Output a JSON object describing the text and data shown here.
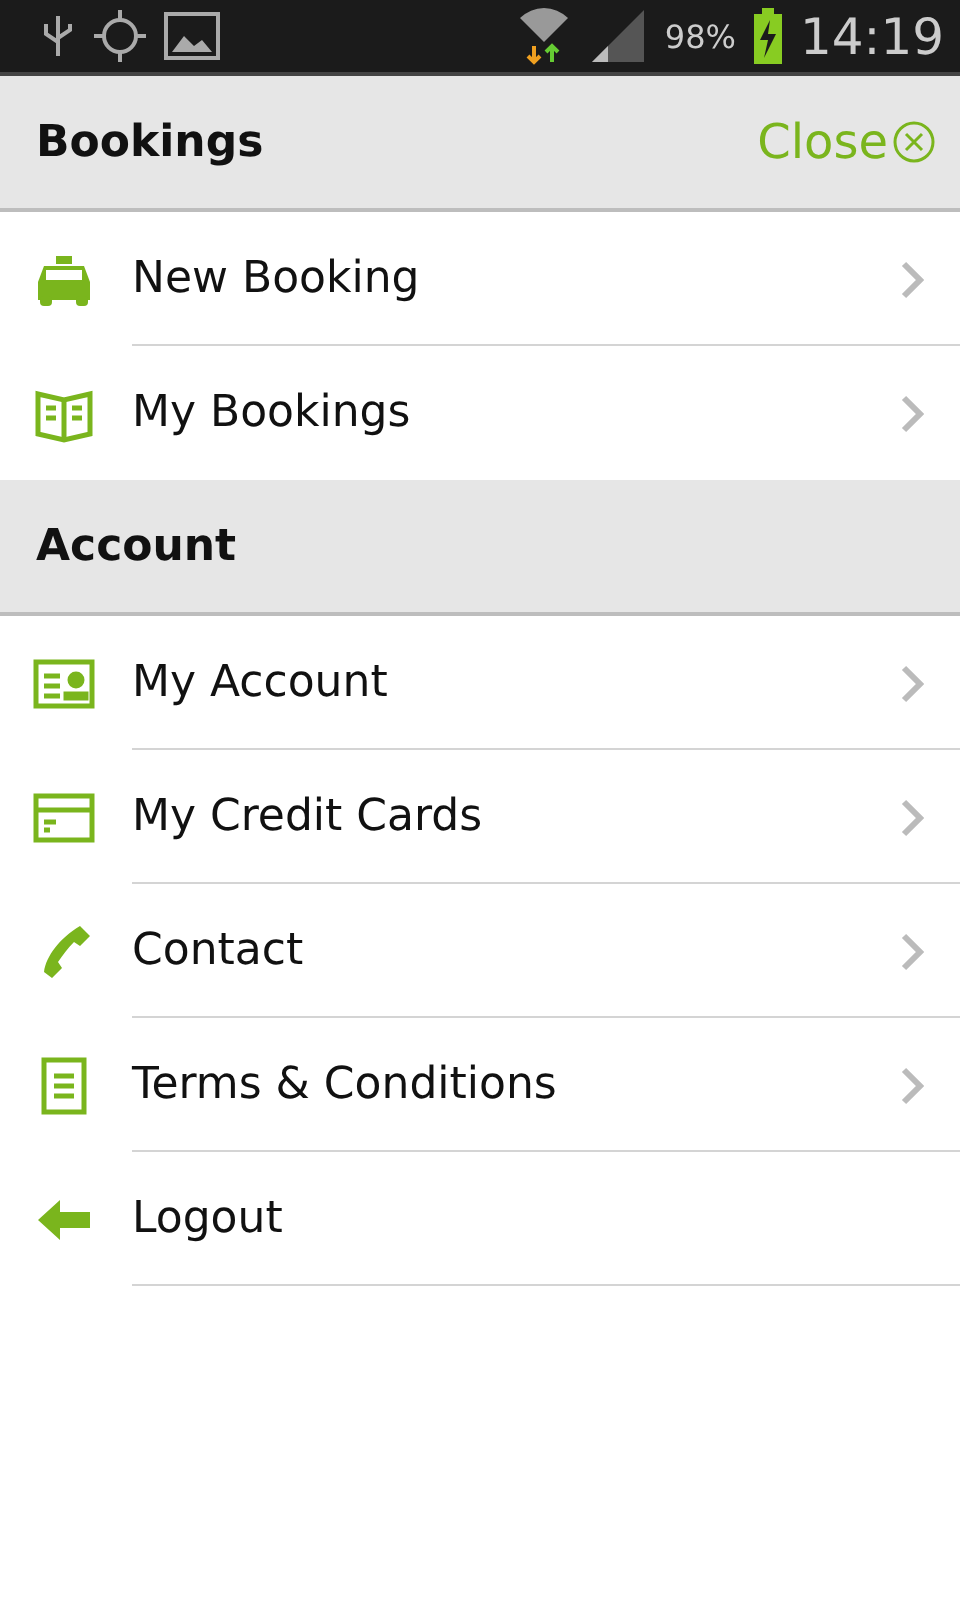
{
  "status_bar": {
    "battery": "98%",
    "time": "14:19"
  },
  "sections": [
    {
      "title": "Bookings",
      "close": {
        "label": "Close"
      },
      "items": [
        {
          "label": "New Booking",
          "kind": "taxi",
          "chevron": true
        },
        {
          "label": "My Bookings",
          "kind": "book",
          "chevron": true
        }
      ]
    },
    {
      "title": "Account",
      "items": [
        {
          "label": "My Account",
          "kind": "idcard",
          "chevron": true
        },
        {
          "label": "My Credit Cards",
          "kind": "card",
          "chevron": true
        },
        {
          "label": "Contact",
          "kind": "phone",
          "chevron": true
        },
        {
          "label": "Terms & Conditions",
          "kind": "document",
          "chevron": true
        },
        {
          "label": "Logout",
          "kind": "back",
          "chevron": false
        }
      ]
    }
  ]
}
